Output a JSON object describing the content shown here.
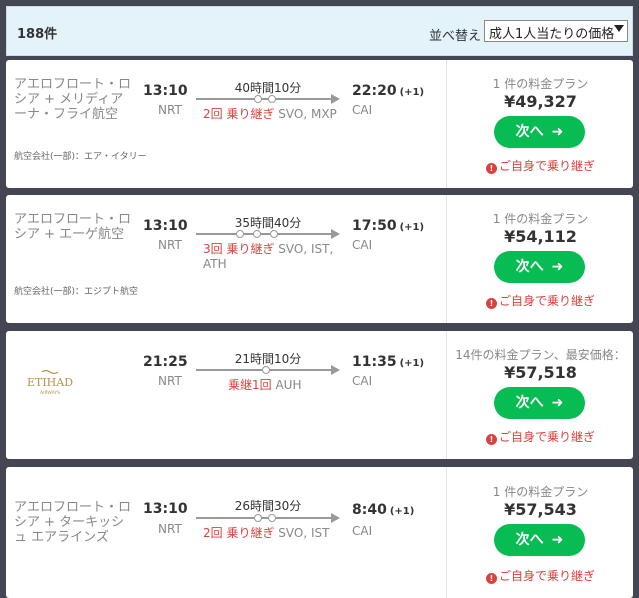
{
  "header": {
    "count": "188件",
    "sort_label": "並べ替え",
    "sort_value": "成人1人当たりの価格"
  },
  "flights": [
    {
      "airline": "アエロフロート・ロシア + メリディアーナ・フライ航空",
      "codeshare": "航空会社(一部)：エア・イタリー",
      "dep_time": "13:10",
      "dep_code": "NRT",
      "duration": "40時間10分",
      "stops_count": "2回 乗り継ぎ",
      "stops_airports": "SVO, MXP",
      "arr_time": "22:20",
      "day_offset": "(+1)",
      "arr_code": "CAI",
      "plan": "1 件の料金プラン",
      "price": "¥49,327",
      "button": "次へ",
      "transfer_note": "ご自身で乗り継ぎ"
    },
    {
      "airline": "アエロフロート・ロシア + エーゲ航空",
      "codeshare": "航空会社(一部)：エジプト航空",
      "dep_time": "13:10",
      "dep_code": "NRT",
      "duration": "35時間40分",
      "stops_count": "3回 乗り継ぎ",
      "stops_airports": "SVO, IST, ATH",
      "arr_time": "17:50",
      "day_offset": "(+1)",
      "arr_code": "CAI",
      "plan": "1 件の料金プラン",
      "price": "¥54,112",
      "button": "次へ",
      "transfer_note": "ご自身で乗り継ぎ"
    },
    {
      "airline_logo_text": "ETIHAD",
      "airline_logo_subtext": "AIRWAYS",
      "dep_time": "21:25",
      "dep_code": "NRT",
      "duration": "21時間10分",
      "stops_count": "乗継1回",
      "stops_airports": "AUH",
      "arr_time": "11:35",
      "day_offset": "(+1)",
      "arr_code": "CAI",
      "plan": "14件の料金プラン、最安価格：",
      "price": "¥57,518",
      "button": "次へ",
      "transfer_note": "ご自身で乗り継ぎ"
    },
    {
      "airline": "アエロフロート・ロシア + ターキッシュ エアラインズ",
      "dep_time": "13:10",
      "dep_code": "NRT",
      "duration": "26時間30分",
      "stops_count": "2回 乗り継ぎ",
      "stops_airports": "SVO, IST",
      "arr_time": "8:40",
      "day_offset": "(+1)",
      "arr_code": "CAI",
      "plan": "1 件の料金プラン",
      "price": "¥57,543",
      "button": "次へ",
      "transfer_note": "ご自身で乗り継ぎ"
    }
  ],
  "colors": {
    "accent_green": "#07bd53",
    "warning_red": "#d9433f",
    "header_bg": "#e3f3f9"
  }
}
